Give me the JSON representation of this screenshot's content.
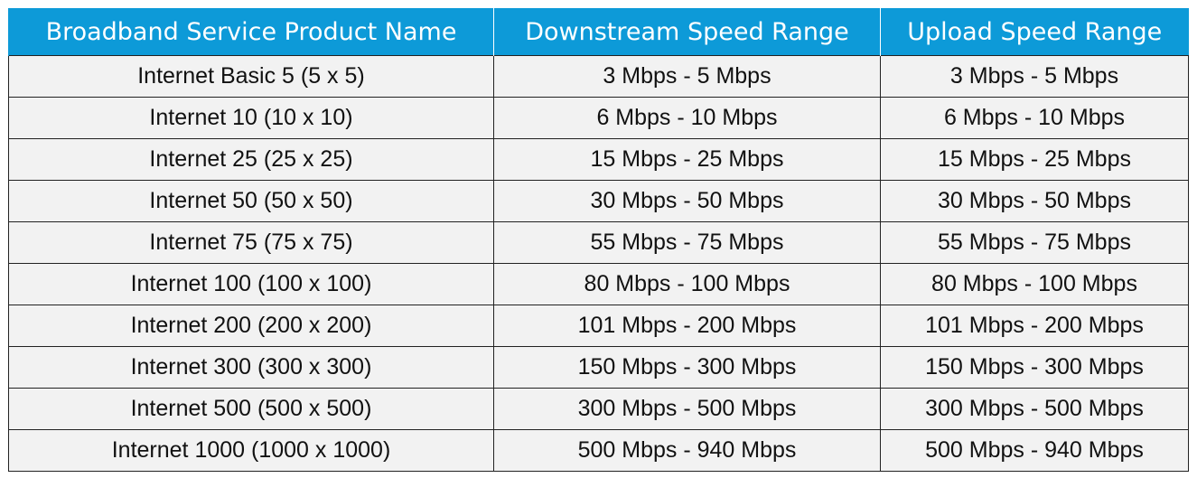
{
  "colors": {
    "header_bg": "#0d9ad8",
    "header_text": "#ffffff",
    "cell_bg": "#f2f2f2",
    "cell_text": "#111111",
    "grid": "#222222"
  },
  "table": {
    "headers": [
      "Broadband Service Product Name",
      "Downstream Speed Range",
      "Upload Speed Range"
    ],
    "rows": [
      [
        "Internet Basic 5 (5 x 5)",
        "3 Mbps - 5 Mbps",
        "3 Mbps - 5 Mbps"
      ],
      [
        "Internet 10 (10 x 10)",
        "6 Mbps - 10 Mbps",
        "6 Mbps - 10 Mbps"
      ],
      [
        "Internet 25 (25 x 25)",
        "15 Mbps - 25 Mbps",
        "15 Mbps - 25 Mbps"
      ],
      [
        "Internet 50 (50 x 50)",
        "30 Mbps - 50 Mbps",
        "30 Mbps - 50 Mbps"
      ],
      [
        "Internet 75 (75 x 75)",
        "55 Mbps - 75 Mbps",
        "55 Mbps - 75 Mbps"
      ],
      [
        "Internet 100 (100 x 100)",
        "80 Mbps - 100 Mbps",
        "80 Mbps - 100 Mbps"
      ],
      [
        "Internet 200 (200 x 200)",
        "101 Mbps - 200 Mbps",
        "101 Mbps - 200 Mbps"
      ],
      [
        "Internet 300 (300 x 300)",
        "150 Mbps - 300 Mbps",
        "150 Mbps - 300 Mbps"
      ],
      [
        "Internet 500 (500 x 500)",
        "300 Mbps - 500 Mbps",
        "300 Mbps - 500 Mbps"
      ],
      [
        "Internet 1000 (1000 x 1000)",
        "500 Mbps - 940 Mbps",
        "500 Mbps - 940 Mbps"
      ]
    ]
  }
}
